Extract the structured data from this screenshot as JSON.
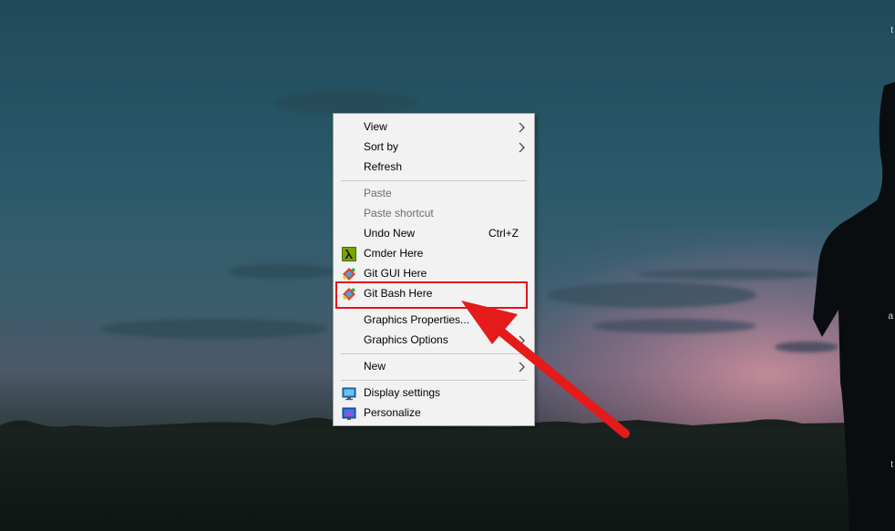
{
  "context_menu": {
    "items": [
      {
        "label": "View",
        "submenu": true
      },
      {
        "label": "Sort by",
        "submenu": true
      },
      {
        "label": "Refresh"
      },
      {
        "label": "Paste",
        "disabled": true
      },
      {
        "label": "Paste shortcut",
        "disabled": true
      },
      {
        "label": "Undo New",
        "shortcut": "Ctrl+Z"
      },
      {
        "label": "Cmder Here",
        "icon": "lambda-icon"
      },
      {
        "label": "Git GUI Here",
        "icon": "git-icon"
      },
      {
        "label": "Git Bash Here",
        "icon": "git-icon"
      },
      {
        "label": "Graphics Properties..."
      },
      {
        "label": "Graphics Options",
        "submenu": true
      },
      {
        "label": "New",
        "submenu": true
      },
      {
        "label": "Display settings",
        "icon": "monitor-icon"
      },
      {
        "label": "Personalize",
        "icon": "personalize-icon"
      }
    ],
    "highlighted_item": "Git Bash Here"
  },
  "icons": {
    "cmder": "lambda-icon",
    "git": "git-icon",
    "display": "monitor-icon",
    "personalize": "personalize-icon",
    "submenu": "chevron-right-icon"
  },
  "edge_glyphs": {
    "top": "t",
    "middle": "a",
    "bottom": "t"
  },
  "colors": {
    "menu_bg": "#f2f2f2",
    "highlight": "#e0141c",
    "arrow": "#e51a1a"
  }
}
